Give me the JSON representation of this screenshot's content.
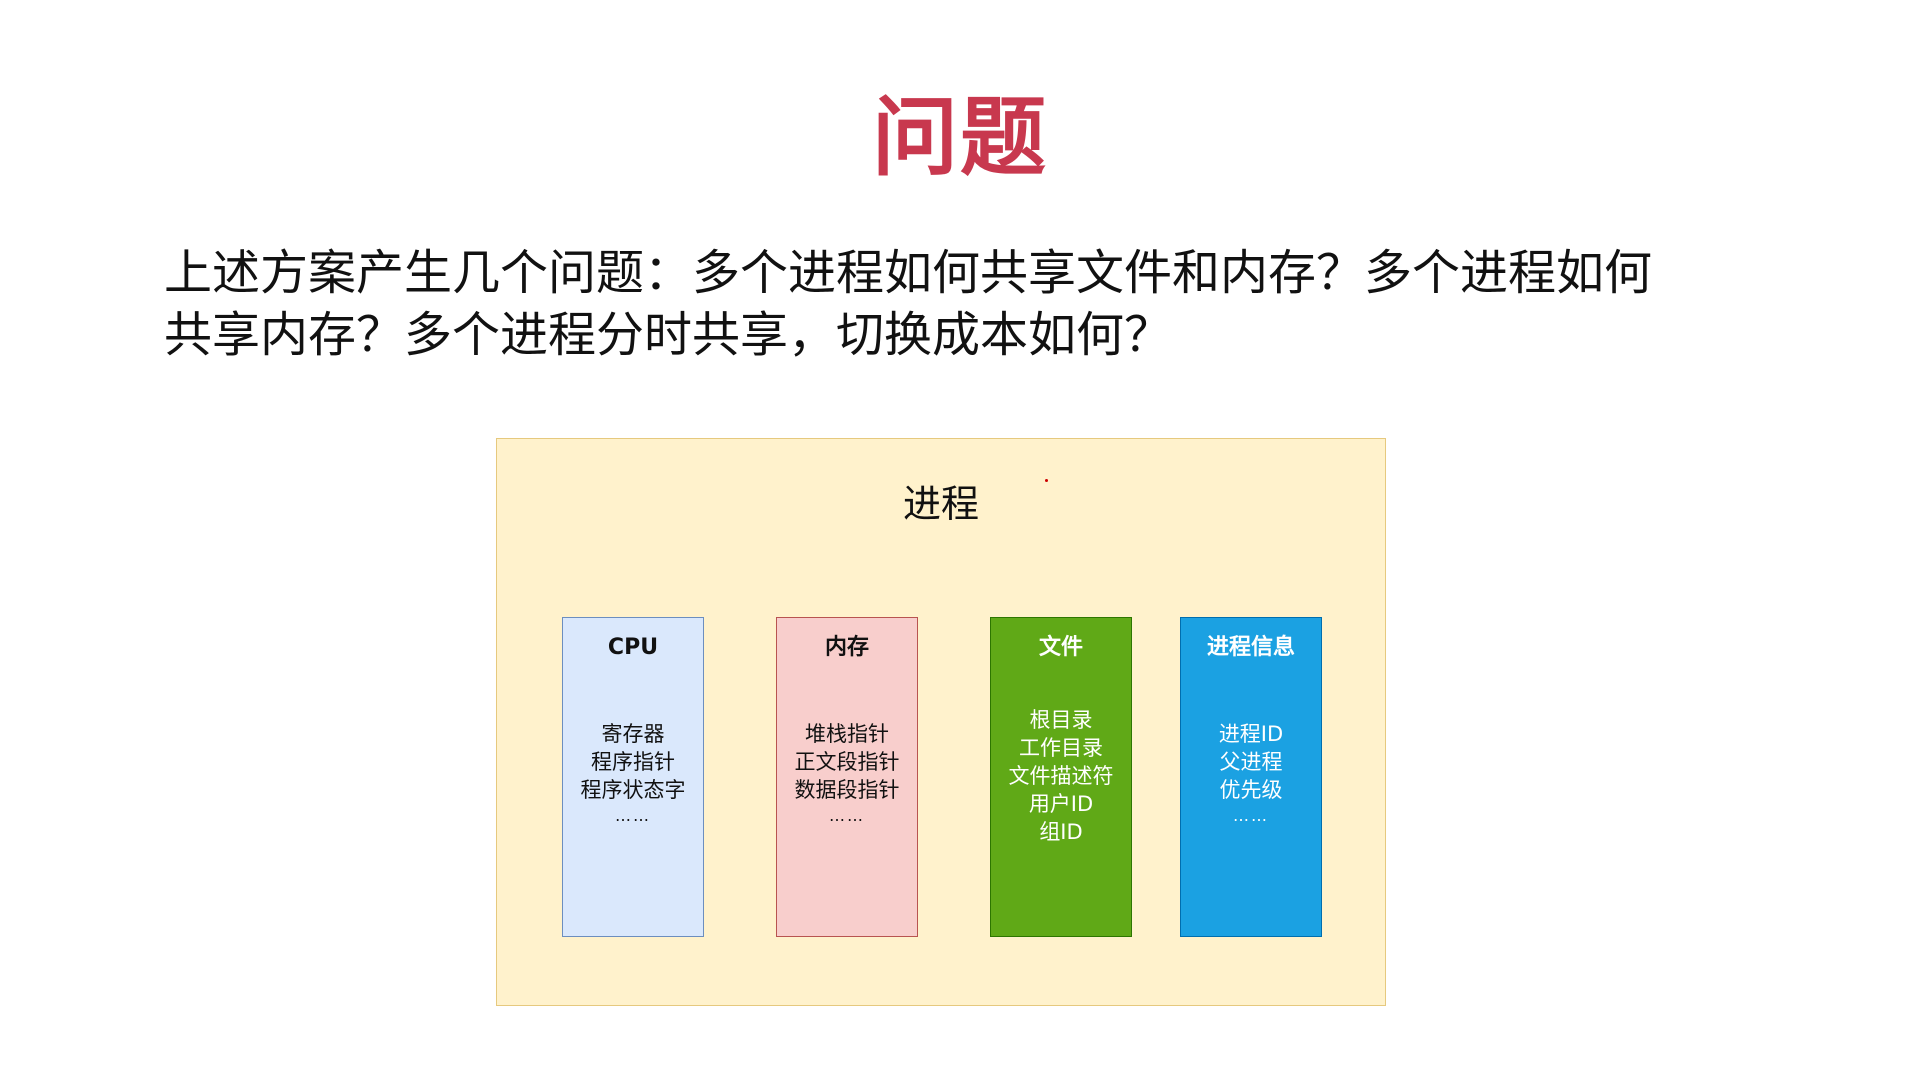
{
  "slide": {
    "title": "问题",
    "title_color": "#c8384e",
    "body_line1": "上述方案产生几个问题：多个进程如何共享文件和内存？多个进程如何",
    "body_line2": "共享内存？多个进程分时共享，切换成本如何？"
  },
  "diagram": {
    "title": "进程",
    "background": "#fff2cc",
    "accent_dot_color": "#cc0000",
    "boxes": [
      {
        "title": "CPU",
        "lines": [
          "寄存器",
          "程序指针",
          "程序状态字"
        ],
        "ellipsis": "……",
        "fill": "#dae8fc",
        "border": "#6c8ebf",
        "text_color": "#111111"
      },
      {
        "title": "内存",
        "lines": [
          "堆栈指针",
          "正文段指针",
          "数据段指针"
        ],
        "ellipsis": "……",
        "fill": "#f8cecc",
        "border": "#b85450",
        "text_color": "#111111"
      },
      {
        "title": "文件",
        "lines": [
          "根目录",
          "工作目录",
          "文件描述符",
          "用户ID",
          "组ID"
        ],
        "ellipsis": "",
        "fill": "#60a917",
        "border": "#2d7600",
        "text_color": "#ffffff"
      },
      {
        "title": "进程信息",
        "lines": [
          "进程ID",
          "父进程",
          "优先级"
        ],
        "ellipsis": "……",
        "fill": "#1ba1e2",
        "border": "#006eaf",
        "text_color": "#ffffff"
      }
    ]
  }
}
